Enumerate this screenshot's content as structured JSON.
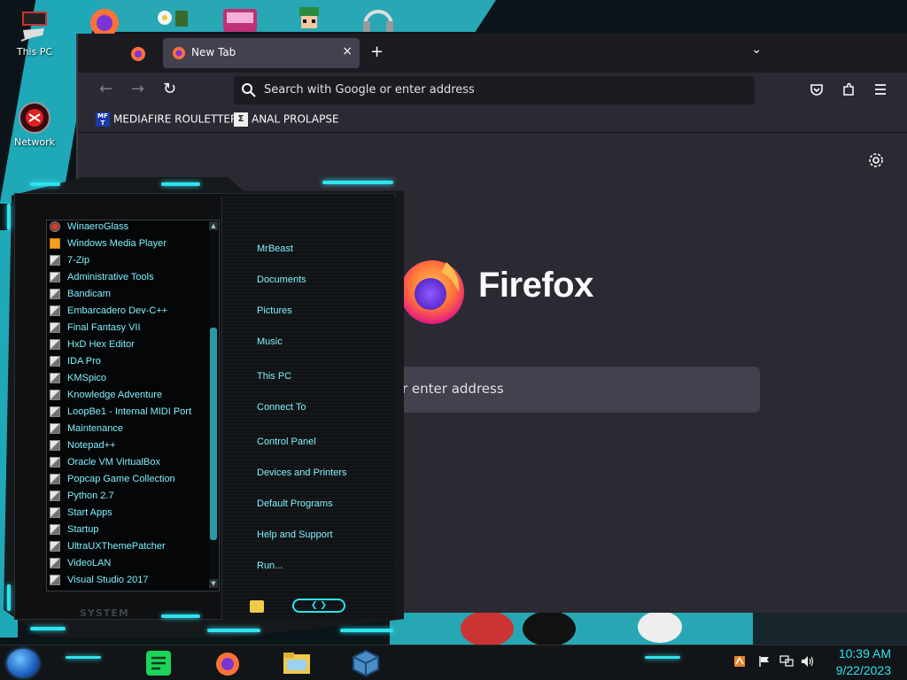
{
  "desktop": {
    "icons": [
      {
        "label": "This PC",
        "icon": "this-pc-icon"
      },
      {
        "label": "Network",
        "icon": "network-icon"
      }
    ]
  },
  "firefox": {
    "tab_title": "New Tab",
    "tab_close": "×",
    "new_tab": "+",
    "tab_list": "⌄",
    "nav": {
      "back": "←",
      "forward": "→",
      "reload": "↻"
    },
    "url_placeholder": "Search with Google or enter address",
    "toolbar_icons": [
      "pocket-icon",
      "extensions-icon",
      "menu-icon"
    ],
    "bookmarks": [
      {
        "label": "MEDIAFIRE ROULETTER",
        "icon_text": "MF T"
      },
      {
        "label": "ANAL PROLAPSE",
        "icon_text": "Σ"
      }
    ],
    "brand": "Firefox",
    "big_search_placeholder": "r enter address",
    "settings_icon": "gear-icon"
  },
  "start_menu": {
    "programs": [
      {
        "label": "WinaeroGlass",
        "kind": "winaero"
      },
      {
        "label": "Windows Media Player",
        "kind": "wmp"
      },
      {
        "label": "7-Zip",
        "kind": "folder"
      },
      {
        "label": "Administrative Tools",
        "kind": "folder"
      },
      {
        "label": "Bandicam",
        "kind": "folder"
      },
      {
        "label": "Embarcadero Dev-C++",
        "kind": "folder"
      },
      {
        "label": "Final Fantasy VII",
        "kind": "folder"
      },
      {
        "label": "HxD Hex Editor",
        "kind": "folder"
      },
      {
        "label": "IDA Pro",
        "kind": "folder"
      },
      {
        "label": "KMSpico",
        "kind": "folder"
      },
      {
        "label": "Knowledge Adventure",
        "kind": "folder"
      },
      {
        "label": "LoopBe1 - Internal MIDI Port",
        "kind": "folder"
      },
      {
        "label": "Maintenance",
        "kind": "folder"
      },
      {
        "label": "Notepad++",
        "kind": "folder"
      },
      {
        "label": "Oracle VM VirtualBox",
        "kind": "folder"
      },
      {
        "label": "Popcap Game Collection",
        "kind": "folder"
      },
      {
        "label": "Python 2.7",
        "kind": "folder"
      },
      {
        "label": "Start Apps",
        "kind": "folder"
      },
      {
        "label": "Startup",
        "kind": "folder"
      },
      {
        "label": "UltraUXThemePatcher",
        "kind": "folder"
      },
      {
        "label": "VideoLAN",
        "kind": "folder"
      },
      {
        "label": "Visual Studio 2017",
        "kind": "folder"
      }
    ],
    "places": [
      {
        "label": "MrBeast"
      },
      {
        "label": "Documents"
      },
      {
        "label": "Pictures"
      },
      {
        "label": "Music"
      },
      {
        "label": "This PC"
      },
      {
        "label": "Connect To"
      },
      {
        "label": "Control Panel"
      },
      {
        "label": "Devices and Printers"
      },
      {
        "label": "Default Programs"
      },
      {
        "label": "Help and Support"
      },
      {
        "label": "Run..."
      }
    ],
    "system_label": "SYSTEM",
    "arrows": "❮ ❯"
  },
  "taskbar": {
    "pinned": [
      "notes-app-icon",
      "firefox-icon",
      "file-explorer-icon",
      "virtualbox-icon"
    ],
    "tray_icons": [
      "app-tray-icon",
      "flag-icon",
      "network-tray-icon",
      "volume-icon"
    ],
    "time": "10:39 AM",
    "date": "9/22/2023"
  },
  "colors": {
    "accent": "#2fe3f0",
    "menu_text": "#7ef0ff",
    "firefox_bg": "#2b2a33"
  }
}
